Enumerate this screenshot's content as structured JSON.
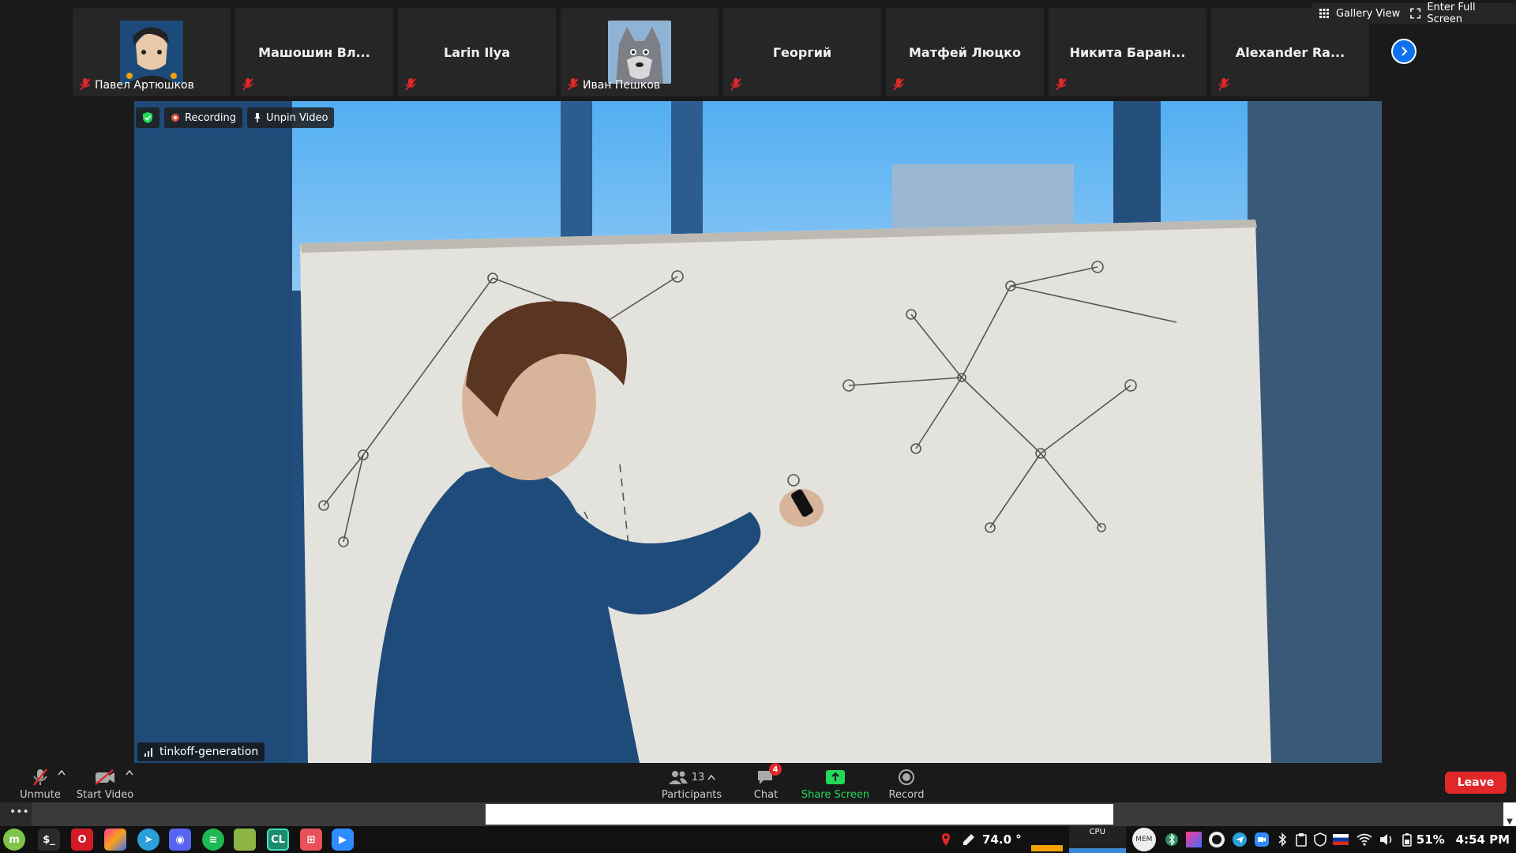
{
  "participants": [
    {
      "name": "Павел Артюшков",
      "has_avatar": true,
      "avatar": "cartoon-man-avatar"
    },
    {
      "name": "Машошин Вл...",
      "has_avatar": false
    },
    {
      "name": "Larin Ilya",
      "has_avatar": false
    },
    {
      "name": "Иван Пешков",
      "has_avatar": true,
      "avatar": "wolf-avatar"
    },
    {
      "name": "Георгий",
      "has_avatar": false
    },
    {
      "name": "Матфей Люцко",
      "has_avatar": false
    },
    {
      "name": "Никита Баран...",
      "has_avatar": false
    },
    {
      "name": "Alexander Ra...",
      "has_avatar": false
    }
  ],
  "top_controls": {
    "gallery_view": "Gallery View",
    "full_screen": "Enter Full Screen"
  },
  "video": {
    "recording_label": "Recording",
    "unpin_label": "Unpin Video",
    "speaker_name": "tinkoff-generation"
  },
  "toolbar": {
    "unmute": "Unmute",
    "start_video": "Start Video",
    "participants_label": "Participants",
    "participants_count": "13",
    "chat_label": "Chat",
    "chat_badge": "4",
    "share_screen": "Share Screen",
    "record": "Record",
    "leave": "Leave"
  },
  "taskbar": {
    "temperature": "74.0 °",
    "cpu_label": "CPU",
    "mem_label": "MEM",
    "battery": "51%",
    "time": "4:54 PM"
  },
  "colors": {
    "accent_blue": "#0e72ed",
    "leave_red": "#e02828",
    "share_green": "#23d959",
    "muted_red": "#e02828"
  }
}
